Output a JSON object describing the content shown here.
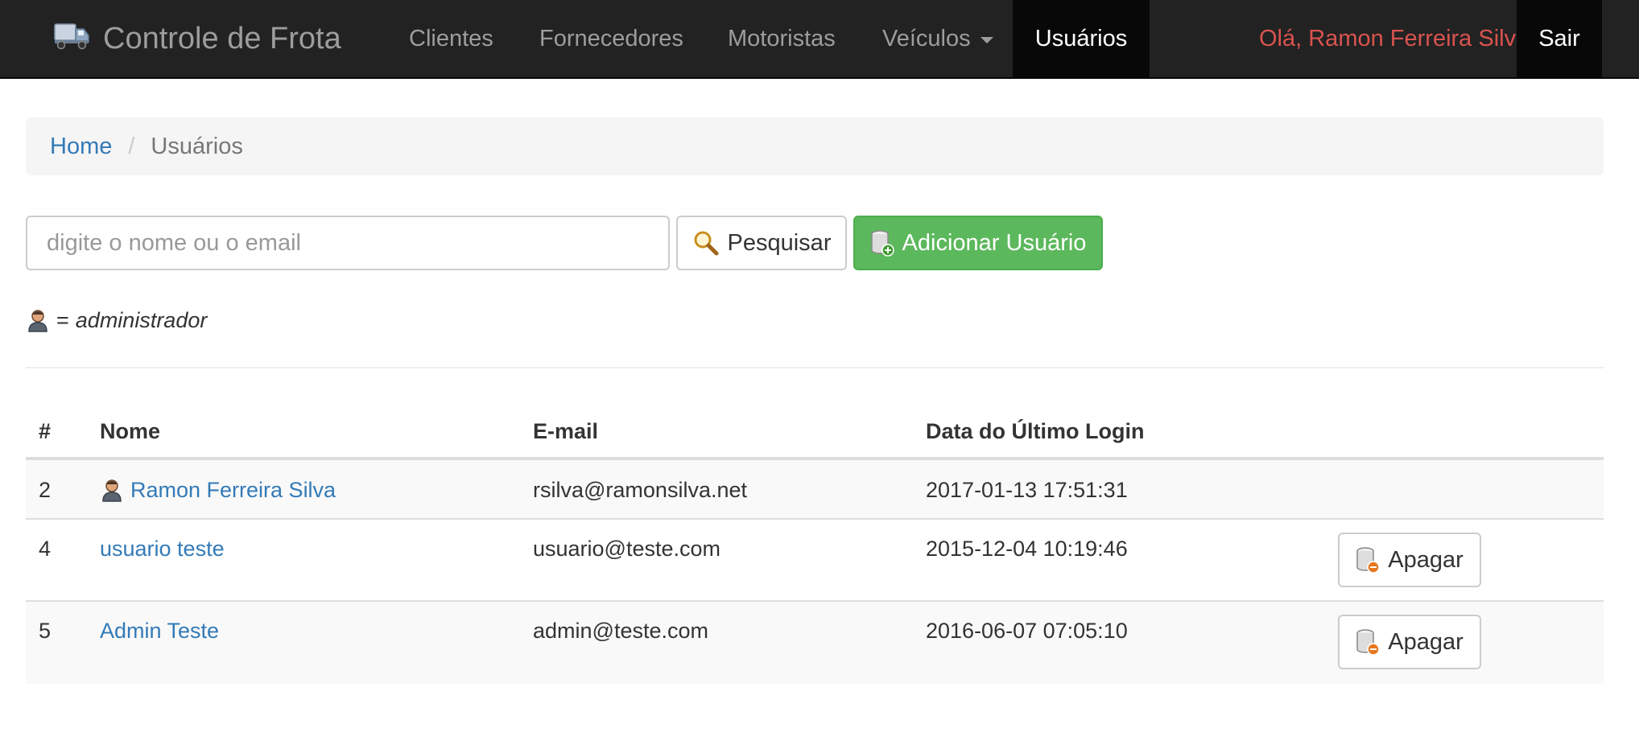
{
  "navbar": {
    "brand": "Controle de Frota",
    "items": [
      {
        "label": "Clientes"
      },
      {
        "label": "Fornecedores"
      },
      {
        "label": "Motoristas"
      },
      {
        "label": "Veículos"
      },
      {
        "label": "Usuários"
      }
    ],
    "greeting": "Olá, Ramon Ferreira Silva",
    "logout": "Sair",
    "colors": {
      "background": "#222222",
      "active": "#080808",
      "greeting": "#d9534f"
    }
  },
  "breadcrumb": {
    "home": "Home",
    "separator": "/",
    "current": "Usuários"
  },
  "search": {
    "placeholder": "digite o nome ou o email",
    "value": "",
    "search_button": "Pesquisar",
    "add_button": "Adicionar Usuário"
  },
  "legend": {
    "equals": "=",
    "text": "administrador",
    "icon": "admin-user-icon"
  },
  "table": {
    "headers": [
      "#",
      "Nome",
      "E-mail",
      "Data do Último Login",
      ""
    ],
    "rows": [
      {
        "id": "2",
        "name": "Ramon Ferreira Silva",
        "admin": true,
        "email": "rsilva@ramonsilva.net",
        "last_login": "2017-01-13 17:51:31",
        "action": ""
      },
      {
        "id": "4",
        "name": "usuario teste",
        "admin": false,
        "email": "usuario@teste.com",
        "last_login": "2015-12-04 10:19:46",
        "action": "Apagar"
      },
      {
        "id": "5",
        "name": "Admin Teste",
        "admin": false,
        "email": "admin@teste.com",
        "last_login": "2016-06-07 07:05:10",
        "action": "Apagar"
      }
    ]
  },
  "colors": {
    "link": "#337ab7",
    "success": "#5cb85c",
    "danger": "#d9534f"
  }
}
